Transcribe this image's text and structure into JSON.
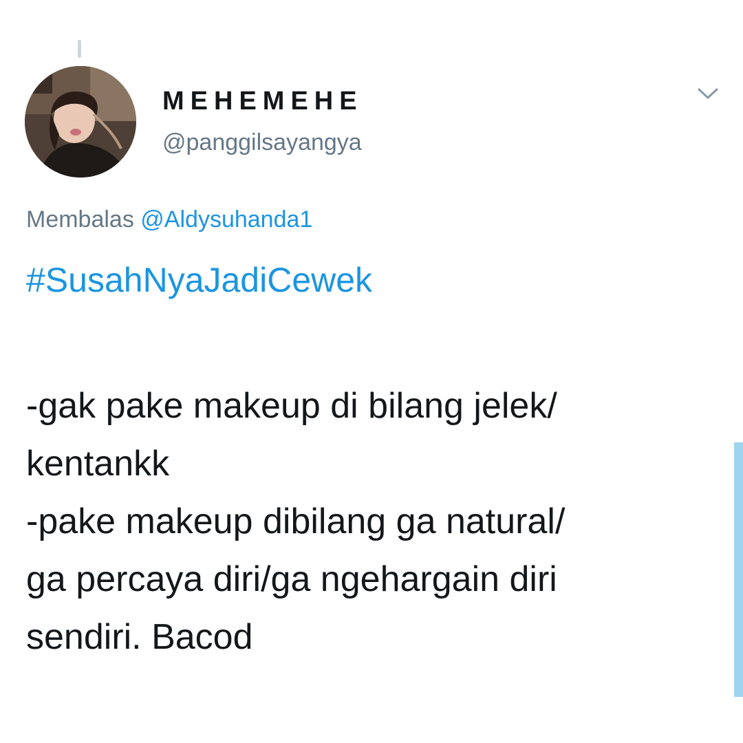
{
  "tweet": {
    "display_name": "MEHEMEHE",
    "handle": "@panggilsayangya",
    "reply_prefix": "Membalas",
    "reply_to": "@Aldysuhanda1",
    "hashtag": "#SusahNyaJadiCewek",
    "body_lines": [
      "-gak pake makeup di bilang jelek/",
      "kentankk",
      "-pake makeup dibilang ga natural/",
      "ga percaya diri/ga ngehargain diri",
      "sendiri. Bacod"
    ]
  },
  "icons": {
    "menu": "chevron-down-icon"
  },
  "colors": {
    "link": "#1b95e0",
    "secondary_text": "#657786",
    "primary_text": "#14171a",
    "scrollbar": "#9fd4ee"
  }
}
